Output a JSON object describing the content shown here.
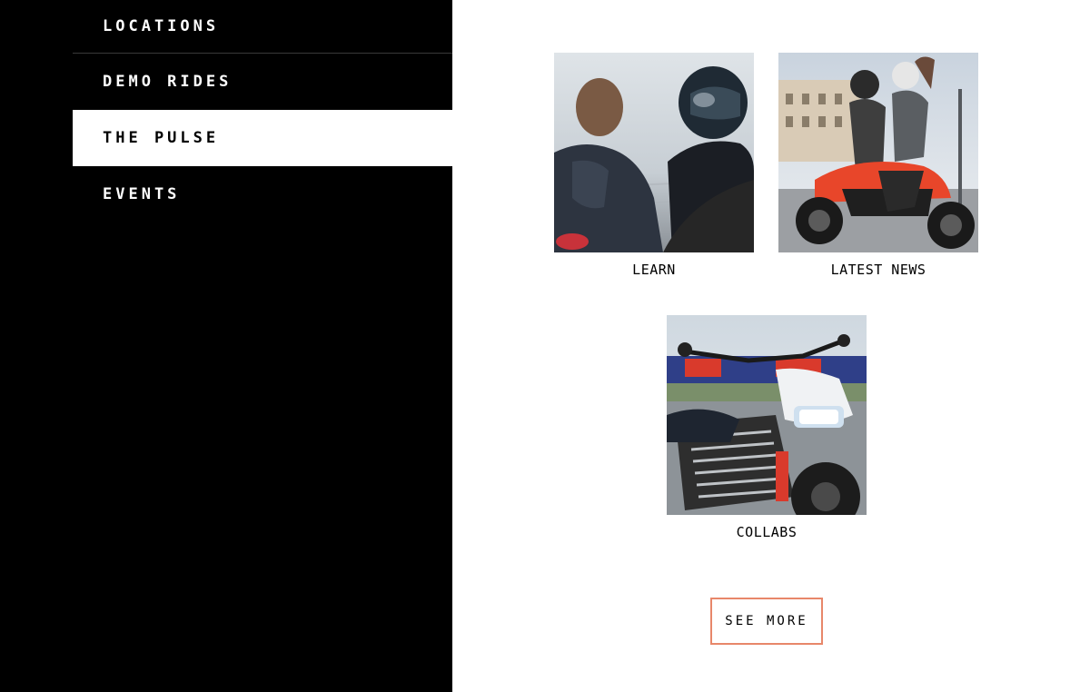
{
  "nav": {
    "items": [
      {
        "label": "LOCATIONS"
      },
      {
        "label": "DEMO RIDES"
      },
      {
        "label": "THE PULSE"
      },
      {
        "label": "EVENTS"
      }
    ]
  },
  "cards": [
    {
      "label": "LEARN",
      "image": "two-riders-with-helmets-photo"
    },
    {
      "label": "LATEST NEWS",
      "image": "riders-on-orange-motorcycle-photo"
    },
    {
      "label": "COLLABS",
      "image": "motorcycle-front-closeup-photo"
    }
  ],
  "actions": {
    "see_more": "SEE MORE"
  },
  "colors": {
    "panel_dark": "#000000",
    "button_border": "#e8876a",
    "accent_orange": "#e8462a"
  }
}
